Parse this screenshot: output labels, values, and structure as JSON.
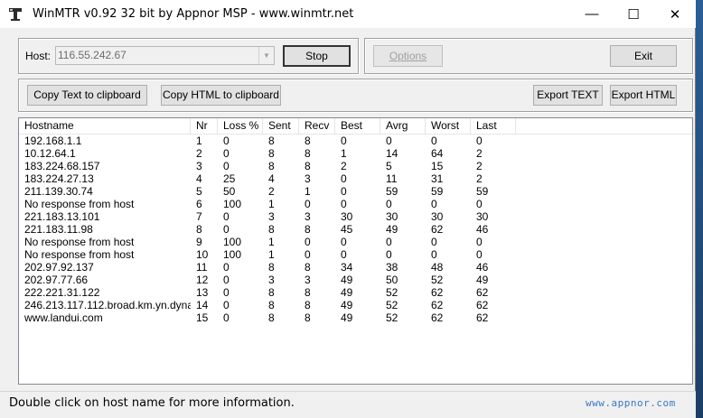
{
  "window": {
    "title": "WinMTR v0.92 32 bit by Appnor MSP - www.winmtr.net",
    "min_glyph": "—",
    "max_glyph": "☐",
    "close_glyph": "✕",
    "icon": "winmtr-app-icon"
  },
  "host": {
    "label": "Host:",
    "value": "116.55.242.67",
    "dropdown_glyph": "▼"
  },
  "buttons": {
    "stop": "Stop",
    "options": "Options",
    "exit": "Exit",
    "copy_text": "Copy Text to clipboard",
    "copy_html": "Copy HTML to clipboard",
    "export_text": "Export TEXT",
    "export_html": "Export HTML"
  },
  "table": {
    "columns": [
      "Hostname",
      "Nr",
      "Loss %",
      "Sent",
      "Recv",
      "Best",
      "Avrg",
      "Worst",
      "Last"
    ],
    "rows": [
      [
        "192.168.1.1",
        "1",
        "0",
        "8",
        "8",
        "0",
        "0",
        "0",
        "0"
      ],
      [
        "10.12.64.1",
        "2",
        "0",
        "8",
        "8",
        "1",
        "14",
        "64",
        "2"
      ],
      [
        "183.224.68.157",
        "3",
        "0",
        "8",
        "8",
        "2",
        "5",
        "15",
        "2"
      ],
      [
        "183.224.27.13",
        "4",
        "25",
        "4",
        "3",
        "0",
        "11",
        "31",
        "2"
      ],
      [
        "211.139.30.74",
        "5",
        "50",
        "2",
        "1",
        "0",
        "59",
        "59",
        "59"
      ],
      [
        "No response from host",
        "6",
        "100",
        "1",
        "0",
        "0",
        "0",
        "0",
        "0"
      ],
      [
        "221.183.13.101",
        "7",
        "0",
        "3",
        "3",
        "30",
        "30",
        "30",
        "30"
      ],
      [
        "221.183.11.98",
        "8",
        "0",
        "8",
        "8",
        "45",
        "49",
        "62",
        "46"
      ],
      [
        "No response from host",
        "9",
        "100",
        "1",
        "0",
        "0",
        "0",
        "0",
        "0"
      ],
      [
        "No response from host",
        "10",
        "100",
        "1",
        "0",
        "0",
        "0",
        "0",
        "0"
      ],
      [
        "202.97.92.137",
        "11",
        "0",
        "8",
        "8",
        "34",
        "38",
        "48",
        "46"
      ],
      [
        "202.97.77.66",
        "12",
        "0",
        "3",
        "3",
        "49",
        "50",
        "52",
        "49"
      ],
      [
        "222.221.31.122",
        "13",
        "0",
        "8",
        "8",
        "49",
        "52",
        "62",
        "62"
      ],
      [
        "246.213.117.112.broad.km.yn.dyna...",
        "14",
        "0",
        "8",
        "8",
        "49",
        "52",
        "62",
        "62"
      ],
      [
        "www.landui.com",
        "15",
        "0",
        "8",
        "8",
        "49",
        "52",
        "62",
        "62"
      ]
    ]
  },
  "status": {
    "text": "Double click on host name for more information."
  },
  "watermark": "www.appnor.com"
}
